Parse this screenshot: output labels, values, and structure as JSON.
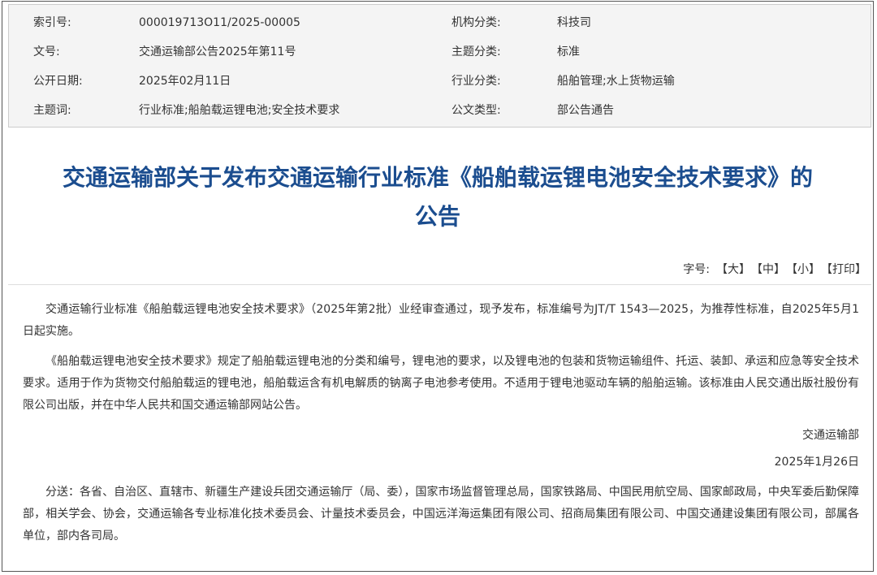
{
  "meta": {
    "rows": [
      {
        "label1": "索引号:",
        "value1": "000019713O11/2025-00005",
        "label2": "机构分类:",
        "value2": "科技司"
      },
      {
        "label1": "文号:",
        "value1": "交通运输部公告2025年第11号",
        "label2": "主题分类:",
        "value2": "标准"
      },
      {
        "label1": "公开日期:",
        "value1": "2025年02月11日",
        "label2": "行业分类:",
        "value2": "船舶管理;水上货物运输"
      },
      {
        "label1": "主题词:",
        "value1": "行业标准;船舶载运锂电池;安全技术要求",
        "label2": "公文类型:",
        "value2": "部公告通告"
      }
    ]
  },
  "title": {
    "line1": "交通运输部关于发布交通运输行业标准《船舶载运锂电池安全技术要求》的",
    "line2": "公告"
  },
  "fontsize": {
    "label": "字号:",
    "large": "【大】",
    "medium": "【中】",
    "small": "【小】",
    "print": "【打印】"
  },
  "body": {
    "para1": "交通运输行业标准《船舶载运锂电池安全技术要求》（2025年第2批）业经审查通过，现予发布，标准编号为JT/T 1543—2025，为推荐性标准，自2025年5月1日起实施。",
    "para2": "《船舶载运锂电池安全技术要求》规定了船舶载运锂电池的分类和编号，锂电池的要求，以及锂电池的包装和货物运输组件、托运、装卸、承运和应急等安全技术要求。适用于作为货物交付船舶载运的锂电池，船舶载运含有机电解质的钠离子电池参考使用。不适用于锂电池驱动车辆的船舶运输。该标准由人民交通出版社股份有限公司出版，并在中华人民共和国交通运输部网站公告。",
    "signer": "交通运输部",
    "date": "2025年1月26日",
    "distribution": "分送：各省、自治区、直辖市、新疆生产建设兵团交通运输厅（局、委），国家市场监督管理总局，国家铁路局、中国民用航空局、国家邮政局，中央军委后勤保障部，相关学会、协会，交通运输各专业标准化技术委员会、计量技术委员会，中国远洋海运集团有限公司、招商局集团有限公司、中国交通建设集团有限公司，部属各单位，部内各司局。"
  }
}
